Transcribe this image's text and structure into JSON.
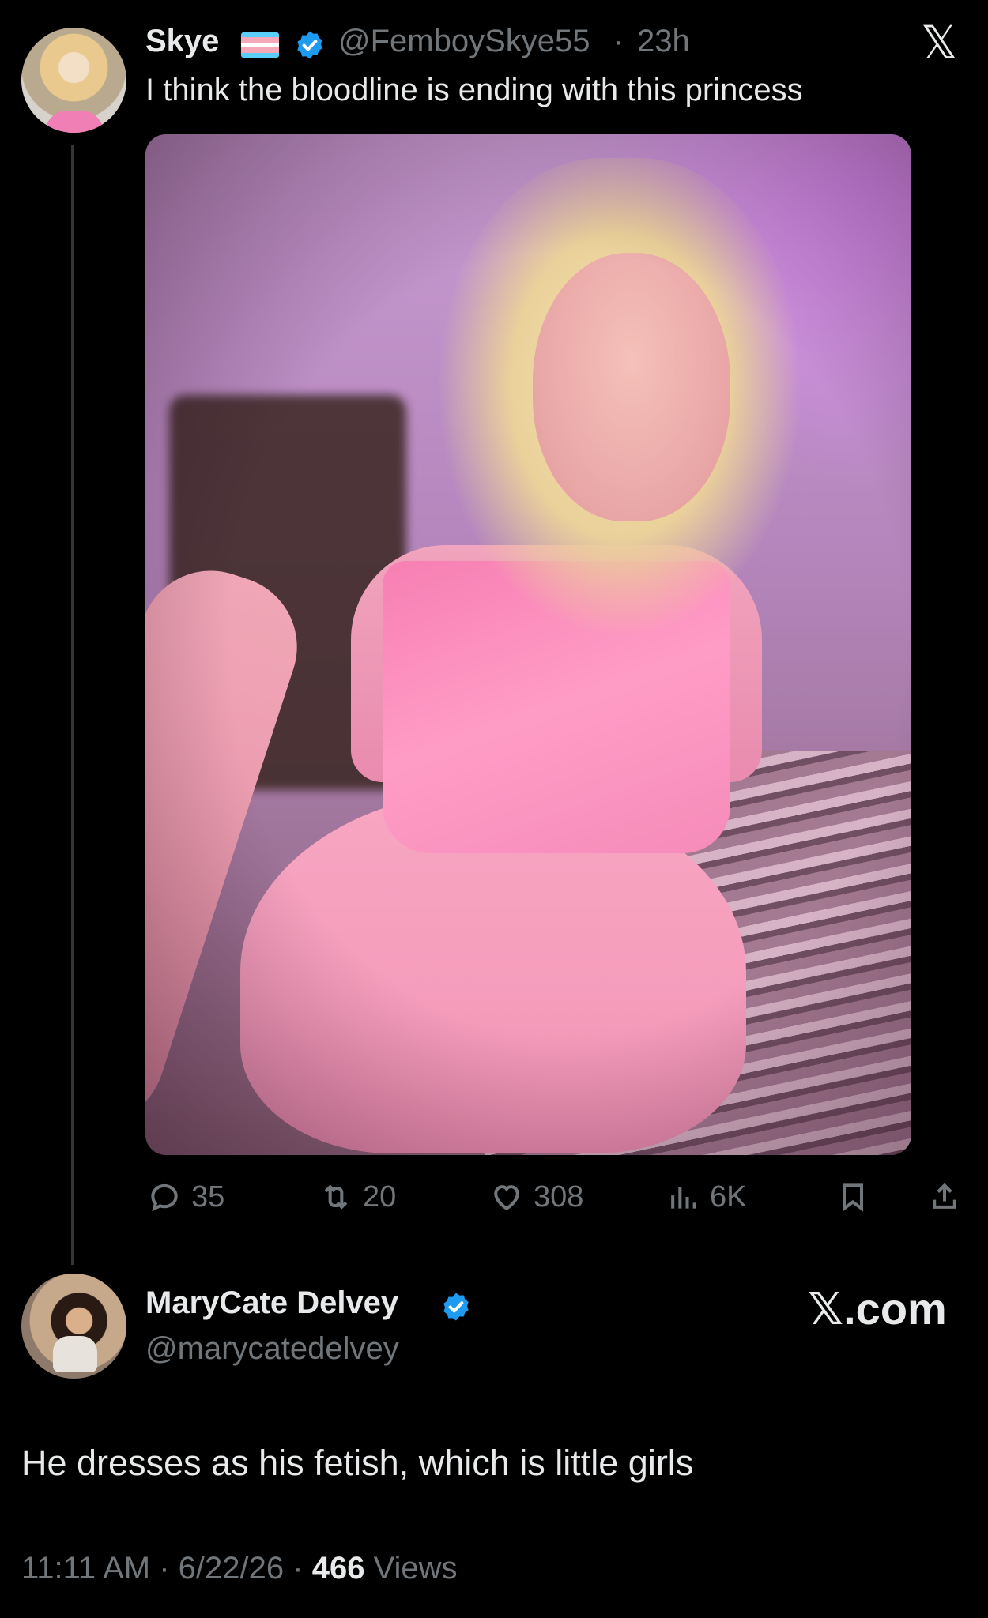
{
  "tweet": {
    "author_name": "Skye",
    "author_handle": "@FemboySkye55",
    "separator": "·",
    "time_ago": "23h",
    "text": "I think the bloodline is ending with this princess",
    "flag_colors": [
      "#5bcefa",
      "#f5a9b8",
      "#ffffff",
      "#f5a9b8",
      "#5bcefa"
    ],
    "verified_color": "#1d9bf0",
    "logo_glyph": "𝕏",
    "stats": {
      "replies": "35",
      "retweets": "20",
      "likes": "308",
      "views": "6K"
    },
    "icons": [
      "reply-icon",
      "retweet-icon",
      "like-icon",
      "views-icon",
      "bookmark-icon",
      "share-icon"
    ]
  },
  "quote": {
    "author_name": "MaryCate Delvey",
    "author_handle": "@marycatedelvey",
    "site_label": "𝕏.com",
    "text": "He dresses as his fetish, which is little girls",
    "time": "11:11 AM",
    "date": "6/22/26",
    "separator": "·",
    "views_count": "466",
    "views_label": "Views"
  }
}
